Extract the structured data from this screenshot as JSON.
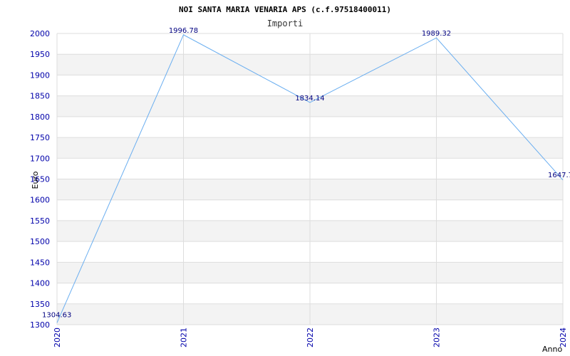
{
  "chart_data": {
    "type": "line",
    "title": "NOI SANTA MARIA VENARIA APS (c.f.97518400011)",
    "subtitle": "Importi",
    "xlabel": "Anno",
    "ylabel": "Euro",
    "x": [
      "2020",
      "2021",
      "2022",
      "2023",
      "2024"
    ],
    "series": [
      {
        "values": [
          1304.63,
          1996.78,
          1834.14,
          1989.32,
          1647.7
        ],
        "labels": [
          "1304.63",
          "1996.78",
          "1834.14",
          "1989.32",
          "1647.7"
        ]
      }
    ],
    "ylim": [
      1300,
      2000
    ],
    "yticks": [
      "1300",
      "1350",
      "1400",
      "1450",
      "1500",
      "1550",
      "1600",
      "1650",
      "1700",
      "1750",
      "1800",
      "1850",
      "1900",
      "1950",
      "2000"
    ],
    "grid": true,
    "colors": {
      "line": "#6aaef0",
      "band": "#f3f3f3",
      "grid": "#dddddd",
      "tick_text": "#0000aa",
      "data_label": "#000080"
    }
  }
}
